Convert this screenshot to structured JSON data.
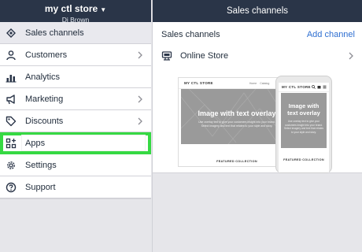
{
  "store": {
    "name": "my ctl store",
    "user": "Dj Brown",
    "caret_icon": "caret-down-icon"
  },
  "sidebar": {
    "items": [
      {
        "key": "sales-channels",
        "label": "Sales channels",
        "icon": "storefront-icon",
        "chevron": false,
        "selected": true
      },
      {
        "key": "customers",
        "label": "Customers",
        "icon": "person-icon",
        "chevron": true
      },
      {
        "key": "analytics",
        "label": "Analytics",
        "icon": "bar-chart-icon",
        "chevron": false
      },
      {
        "key": "marketing",
        "label": "Marketing",
        "icon": "megaphone-icon",
        "chevron": true
      },
      {
        "key": "discounts",
        "label": "Discounts",
        "icon": "tag-icon",
        "chevron": true
      },
      {
        "key": "apps",
        "label": "Apps",
        "icon": "apps-grid-icon",
        "chevron": false,
        "highlighted": true
      },
      {
        "key": "settings",
        "label": "Settings",
        "icon": "gear-icon",
        "chevron": false
      },
      {
        "key": "support",
        "label": "Support",
        "icon": "question-circle-icon",
        "chevron": false
      }
    ]
  },
  "main": {
    "header_title": "Sales channels",
    "section_title": "Sales channels",
    "add_channel_label": "Add channel",
    "channel": {
      "label": "Online Store",
      "icon": "online-store-icon"
    },
    "preview": {
      "desktop_brand": "MY CTL STORE",
      "desktop_links": [
        "Home",
        "Catalog"
      ],
      "hero_title": "Image with text overlay",
      "hero_body": "Use overlay text to give your customers insight into your brand. Select imagery and text that relates to your style and story.",
      "featured": "FEATURED COLLECTION",
      "mobile_brand": "MY CTL STORE",
      "mobile_hero_title": "Image with text overlay",
      "mobile_hero_body": "Use overlay text to give your customers insight into your brand. Select imagery and text that relates to your style and story.",
      "mobile_featured": "FEATURED COLLECTION"
    }
  },
  "colors": {
    "header_bg": "#2a3548",
    "link_blue": "#2f6fd1",
    "highlight_green": "#36d943",
    "hero_gray": "#9a9a9a"
  }
}
